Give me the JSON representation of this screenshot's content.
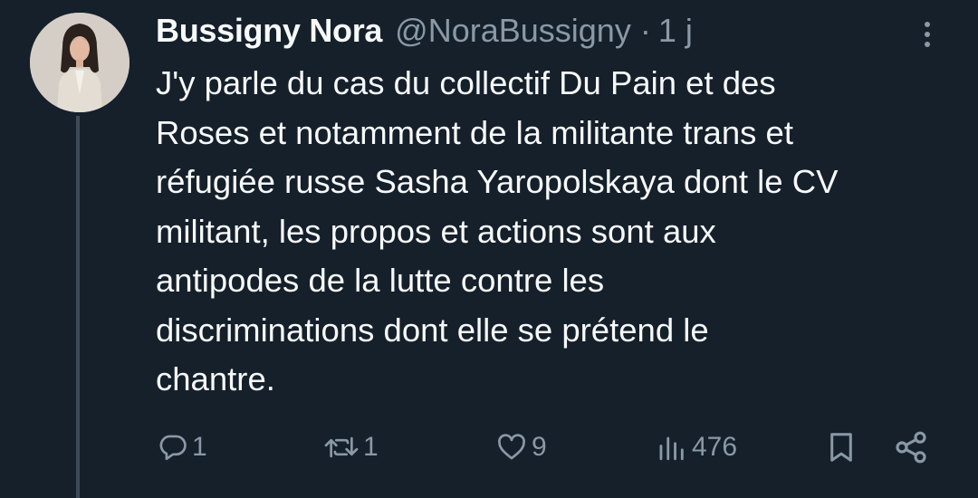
{
  "tweet": {
    "author": {
      "display_name": "Bussigny Nora",
      "handle": "@NoraBussigny",
      "avatar_icon": "profile-photo"
    },
    "separator": "·",
    "time": "1 j",
    "text_lines": [
      "J'y parle du cas du collectif Du Pain et des",
      "Roses et notamment de la militante trans et",
      "réfugiée russe Sasha Yaropolskaya dont le CV",
      "militant, les propos et actions sont aux",
      "antipodes de la lutte contre les",
      "discriminations dont elle se prétend le",
      "chantre."
    ]
  },
  "actions": {
    "reply": {
      "icon": "reply-icon",
      "count": "1"
    },
    "retweet": {
      "icon": "retweet-icon",
      "count": "1"
    },
    "like": {
      "icon": "heart-icon",
      "count": "9"
    },
    "views": {
      "icon": "views-icon",
      "count": "476"
    },
    "bookmark": {
      "icon": "bookmark-icon"
    },
    "share": {
      "icon": "share-icon"
    }
  },
  "colors": {
    "background": "#15202b",
    "text_primary": "#f7f9f9",
    "text_secondary": "#8b98a5",
    "thread_line": "#3e4a56"
  }
}
